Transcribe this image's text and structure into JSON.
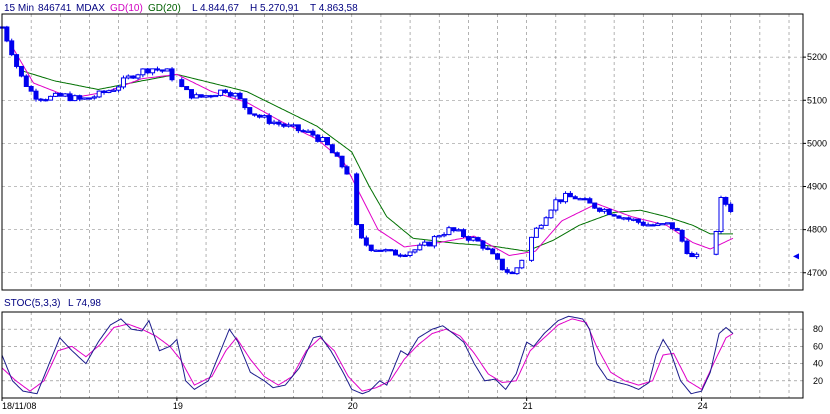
{
  "header": {
    "interval": "15 Min",
    "code": "846741",
    "symbol": "MDAX",
    "ma1_label": "GD(10)",
    "ma2_label": "GD(20)",
    "low": "L  4.844,67",
    "high": "H  5.270,91",
    "last": "T  4.863,58"
  },
  "stoch_header": {
    "label": "STOC(5,3,3)",
    "value": "L  74,98"
  },
  "colors": {
    "candle": "#0000ee",
    "ma10": "#e000c8",
    "ma20": "#007000",
    "stoch_k": "#1c1c8c",
    "stoch_d": "#e000c8",
    "grid": "#808080",
    "header_blue": "#000080",
    "header_magenta": "#d000c0",
    "header_green": "#006000"
  },
  "chart_data": [
    {
      "type": "candlestick",
      "title": "",
      "x_ticks": [
        {
          "t": 0,
          "label": "18/11/08"
        },
        {
          "t": 1,
          "label": "19"
        },
        {
          "t": 2,
          "label": "20"
        },
        {
          "t": 3,
          "label": "21"
        },
        {
          "t": 4,
          "label": "24"
        }
      ],
      "y_ticks": [
        4700,
        4800,
        4900,
        5000,
        5100,
        5200
      ],
      "ylim": [
        4660,
        5300
      ],
      "xlim": [
        0,
        4.58
      ],
      "last_marker": 4738,
      "price_anchors": [
        [
          0.0,
          5270
        ],
        [
          0.05,
          5220
        ],
        [
          0.1,
          5160
        ],
        [
          0.18,
          5112
        ],
        [
          0.26,
          5105
        ],
        [
          0.36,
          5110
        ],
        [
          0.45,
          5100
        ],
        [
          0.55,
          5112
        ],
        [
          0.65,
          5130
        ],
        [
          0.75,
          5160
        ],
        [
          0.85,
          5175
        ],
        [
          0.95,
          5165
        ],
        [
          1.0,
          5140
        ],
        [
          1.05,
          5120
        ],
        [
          1.12,
          5105
        ],
        [
          1.2,
          5115
        ],
        [
          1.28,
          5125
        ],
        [
          1.34,
          5110
        ],
        [
          1.4,
          5080
        ],
        [
          1.48,
          5060
        ],
        [
          1.55,
          5050
        ],
        [
          1.62,
          5040
        ],
        [
          1.7,
          5030
        ],
        [
          1.78,
          5020
        ],
        [
          1.85,
          5000
        ],
        [
          1.92,
          4960
        ],
        [
          1.98,
          4930
        ],
        [
          2.0,
          4860
        ],
        [
          2.04,
          4780
        ],
        [
          2.1,
          4760
        ],
        [
          2.16,
          4755
        ],
        [
          2.22,
          4745
        ],
        [
          2.3,
          4748
        ],
        [
          2.38,
          4755
        ],
        [
          2.44,
          4768
        ],
        [
          2.5,
          4790
        ],
        [
          2.56,
          4800
        ],
        [
          2.62,
          4790
        ],
        [
          2.68,
          4780
        ],
        [
          2.74,
          4768
        ],
        [
          2.8,
          4740
        ],
        [
          2.86,
          4712
        ],
        [
          2.92,
          4695
        ],
        [
          2.97,
          4730
        ],
        [
          3.0,
          4760
        ],
        [
          3.04,
          4790
        ],
        [
          3.1,
          4830
        ],
        [
          3.16,
          4865
        ],
        [
          3.22,
          4875
        ],
        [
          3.28,
          4875
        ],
        [
          3.35,
          4860
        ],
        [
          3.42,
          4850
        ],
        [
          3.5,
          4838
        ],
        [
          3.58,
          4825
        ],
        [
          3.66,
          4815
        ],
        [
          3.74,
          4808
        ],
        [
          3.82,
          4812
        ],
        [
          3.86,
          4795
        ],
        [
          3.9,
          4765
        ],
        [
          3.95,
          4730
        ],
        [
          4.0,
          4740
        ],
        [
          4.07,
          4745
        ],
        [
          4.1,
          4870
        ],
        [
          4.14,
          4860
        ],
        [
          4.18,
          4842
        ]
      ],
      "ma10_anchors": [
        [
          0.05,
          5230
        ],
        [
          0.18,
          5140
        ],
        [
          0.4,
          5105
        ],
        [
          0.6,
          5120
        ],
        [
          0.8,
          5150
        ],
        [
          1.0,
          5160
        ],
        [
          1.2,
          5120
        ],
        [
          1.4,
          5095
        ],
        [
          1.6,
          5050
        ],
        [
          1.8,
          5010
        ],
        [
          1.95,
          4960
        ],
        [
          2.05,
          4880
        ],
        [
          2.15,
          4800
        ],
        [
          2.3,
          4760
        ],
        [
          2.5,
          4770
        ],
        [
          2.7,
          4785
        ],
        [
          2.9,
          4740
        ],
        [
          3.05,
          4750
        ],
        [
          3.2,
          4820
        ],
        [
          3.4,
          4860
        ],
        [
          3.6,
          4830
        ],
        [
          3.8,
          4810
        ],
        [
          3.95,
          4770
        ],
        [
          4.05,
          4755
        ],
        [
          4.18,
          4780
        ]
      ],
      "ma20_anchors": [
        [
          0.1,
          5170
        ],
        [
          0.3,
          5145
        ],
        [
          0.55,
          5125
        ],
        [
          0.8,
          5145
        ],
        [
          1.0,
          5160
        ],
        [
          1.2,
          5140
        ],
        [
          1.4,
          5120
        ],
        [
          1.6,
          5080
        ],
        [
          1.8,
          5040
        ],
        [
          2.0,
          4980
        ],
        [
          2.1,
          4900
        ],
        [
          2.2,
          4830
        ],
        [
          2.35,
          4780
        ],
        [
          2.6,
          4768
        ],
        [
          2.8,
          4762
        ],
        [
          3.0,
          4750
        ],
        [
          3.15,
          4775
        ],
        [
          3.3,
          4810
        ],
        [
          3.5,
          4840
        ],
        [
          3.65,
          4845
        ],
        [
          3.8,
          4830
        ],
        [
          3.95,
          4810
        ],
        [
          4.05,
          4790
        ],
        [
          4.18,
          4790
        ]
      ]
    },
    {
      "type": "line",
      "title": "STOC(5,3,3)",
      "y_ticks": [
        20,
        40,
        60,
        80
      ],
      "ylim": [
        0,
        100
      ],
      "xlim": [
        0,
        4.58
      ],
      "k_anchors": [
        [
          0.0,
          50
        ],
        [
          0.06,
          20
        ],
        [
          0.12,
          8
        ],
        [
          0.2,
          5
        ],
        [
          0.28,
          45
        ],
        [
          0.33,
          70
        ],
        [
          0.4,
          55
        ],
        [
          0.48,
          40
        ],
        [
          0.55,
          65
        ],
        [
          0.62,
          85
        ],
        [
          0.68,
          92
        ],
        [
          0.74,
          80
        ],
        [
          0.8,
          78
        ],
        [
          0.84,
          90
        ],
        [
          0.9,
          55
        ],
        [
          0.96,
          60
        ],
        [
          1.0,
          68
        ],
        [
          1.05,
          20
        ],
        [
          1.1,
          10
        ],
        [
          1.18,
          20
        ],
        [
          1.25,
          55
        ],
        [
          1.3,
          80
        ],
        [
          1.35,
          65
        ],
        [
          1.42,
          30
        ],
        [
          1.5,
          20
        ],
        [
          1.55,
          12
        ],
        [
          1.62,
          15
        ],
        [
          1.7,
          35
        ],
        [
          1.78,
          70
        ],
        [
          1.82,
          72
        ],
        [
          1.88,
          55
        ],
        [
          1.95,
          30
        ],
        [
          2.0,
          10
        ],
        [
          2.06,
          5
        ],
        [
          2.1,
          8
        ],
        [
          2.16,
          20
        ],
        [
          2.2,
          15
        ],
        [
          2.28,
          55
        ],
        [
          2.32,
          50
        ],
        [
          2.38,
          70
        ],
        [
          2.46,
          80
        ],
        [
          2.52,
          84
        ],
        [
          2.58,
          75
        ],
        [
          2.64,
          65
        ],
        [
          2.7,
          40
        ],
        [
          2.76,
          20
        ],
        [
          2.82,
          22
        ],
        [
          2.88,
          10
        ],
        [
          2.94,
          28
        ],
        [
          3.0,
          65
        ],
        [
          3.04,
          60
        ],
        [
          3.1,
          75
        ],
        [
          3.18,
          90
        ],
        [
          3.24,
          95
        ],
        [
          3.32,
          92
        ],
        [
          3.36,
          80
        ],
        [
          3.4,
          40
        ],
        [
          3.46,
          22
        ],
        [
          3.52,
          18
        ],
        [
          3.58,
          15
        ],
        [
          3.64,
          10
        ],
        [
          3.7,
          18
        ],
        [
          3.74,
          50
        ],
        [
          3.78,
          68
        ],
        [
          3.82,
          55
        ],
        [
          3.88,
          20
        ],
        [
          3.94,
          5
        ],
        [
          4.0,
          8
        ],
        [
          4.05,
          30
        ],
        [
          4.1,
          75
        ],
        [
          4.14,
          82
        ],
        [
          4.18,
          75
        ]
      ],
      "d_anchors": [
        [
          0.0,
          35
        ],
        [
          0.08,
          20
        ],
        [
          0.16,
          8
        ],
        [
          0.24,
          20
        ],
        [
          0.32,
          55
        ],
        [
          0.4,
          60
        ],
        [
          0.48,
          48
        ],
        [
          0.56,
          62
        ],
        [
          0.64,
          82
        ],
        [
          0.72,
          86
        ],
        [
          0.8,
          80
        ],
        [
          0.88,
          72
        ],
        [
          0.96,
          60
        ],
        [
          1.02,
          45
        ],
        [
          1.1,
          15
        ],
        [
          1.2,
          25
        ],
        [
          1.28,
          55
        ],
        [
          1.34,
          70
        ],
        [
          1.42,
          45
        ],
        [
          1.5,
          25
        ],
        [
          1.58,
          15
        ],
        [
          1.66,
          25
        ],
        [
          1.74,
          55
        ],
        [
          1.82,
          70
        ],
        [
          1.9,
          55
        ],
        [
          1.98,
          25
        ],
        [
          2.06,
          8
        ],
        [
          2.14,
          12
        ],
        [
          2.22,
          20
        ],
        [
          2.3,
          45
        ],
        [
          2.38,
          62
        ],
        [
          2.46,
          75
        ],
        [
          2.54,
          80
        ],
        [
          2.62,
          72
        ],
        [
          2.7,
          52
        ],
        [
          2.78,
          28
        ],
        [
          2.86,
          18
        ],
        [
          2.94,
          20
        ],
        [
          3.02,
          55
        ],
        [
          3.1,
          70
        ],
        [
          3.18,
          85
        ],
        [
          3.26,
          92
        ],
        [
          3.34,
          88
        ],
        [
          3.4,
          60
        ],
        [
          3.48,
          30
        ],
        [
          3.56,
          20
        ],
        [
          3.64,
          15
        ],
        [
          3.72,
          20
        ],
        [
          3.78,
          50
        ],
        [
          3.84,
          52
        ],
        [
          3.92,
          20
        ],
        [
          4.0,
          10
        ],
        [
          4.08,
          45
        ],
        [
          4.14,
          70
        ],
        [
          4.18,
          75
        ]
      ]
    }
  ]
}
